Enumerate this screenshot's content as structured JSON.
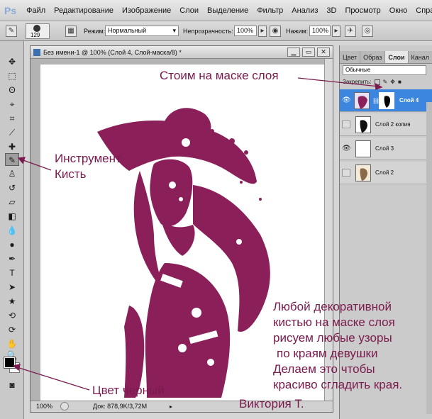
{
  "app": {
    "logo": "Ps"
  },
  "menu": [
    "Файл",
    "Редактирование",
    "Изображение",
    "Слои",
    "Выделение",
    "Фильтр",
    "Анализ",
    "3D",
    "Просмотр",
    "Окно",
    "Справка"
  ],
  "options": {
    "brush_size": "129",
    "mode_label": "Режим:",
    "mode_value": "Нормальный",
    "opacity_label": "Непрозрачность:",
    "opacity_value": "100%",
    "pressure_label": "Нажим:",
    "pressure_value": "100%"
  },
  "document": {
    "title": "Без имени-1 @ 100% (Слой 4, Слой-маска/8) *",
    "zoom": "100%",
    "doc_info": "Док: 878,9K/3,72M"
  },
  "layers_panel": {
    "tabs": [
      "Цвет",
      "Образ",
      "Слои",
      "Канал"
    ],
    "active_tab": "Слои",
    "blend_mode": "Обычные",
    "lock_label": "Закрепить:",
    "layers": [
      {
        "name": "Слой 4",
        "visible": true,
        "active": true
      },
      {
        "name": "Слой 2 копия",
        "visible": false,
        "active": false
      },
      {
        "name": "Слой 3",
        "visible": true,
        "active": false
      },
      {
        "name": "Слой 2",
        "visible": false,
        "active": false
      }
    ]
  },
  "annotations": {
    "mask": "Стоим на маске слоя",
    "tool_line1": "Инструмент",
    "tool_line2": "Кисть",
    "color": "Цвет черный",
    "note_lines": [
      "Любой декоративной",
      "кистью на маске слоя",
      "рисуем любые узоры",
      "по краям  девушки",
      "Делаем это чтобы",
      "красиво сгладить края."
    ],
    "author": "Виктория Т."
  },
  "colors": {
    "figure": "#8b1f5a",
    "annotation": "#7a1a4e",
    "active_layer": "#3d86e0",
    "foreground": "#000000",
    "background": "#ffffff"
  },
  "icons": [
    "move-icon",
    "marquee-icon",
    "lasso-icon",
    "quick-select-icon",
    "crop-icon",
    "eyedropper-icon",
    "healing-icon",
    "brush-icon",
    "clone-stamp-icon",
    "history-brush-icon",
    "eraser-icon",
    "gradient-icon",
    "blur-icon",
    "dodge-icon",
    "pen-icon",
    "type-icon",
    "path-select-icon",
    "shape-icon",
    "3d-rotate-icon",
    "3d-orbit-icon",
    "hand-icon",
    "zoom-icon"
  ]
}
